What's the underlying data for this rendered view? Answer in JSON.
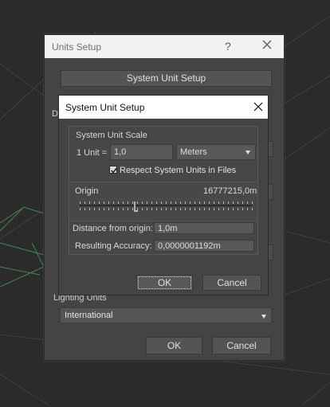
{
  "units_setup": {
    "title": "Units Setup",
    "help": "?",
    "system_unit_setup_button": "System Unit Setup",
    "lighting_units": {
      "label": "Lighting Units",
      "selected": "International"
    },
    "ok": "OK",
    "cancel": "Cancel"
  },
  "system_unit_setup": {
    "title": "System Unit Setup",
    "scale_group_label": "System Unit Scale",
    "unit_label": "1 Unit =",
    "unit_value": "1,0",
    "unit_type": "Meters",
    "respect_checkbox": {
      "label": "Respect System Units in Files",
      "checked": true
    },
    "origin_label": "Origin",
    "origin_value": "16777215,0m",
    "distance_label": "Distance from origin:",
    "distance_value": "1,0m",
    "accuracy_label": "Resulting Accuracy:",
    "accuracy_value": "0,0000001192m",
    "ok": "OK",
    "cancel": "Cancel"
  },
  "icons": {
    "outer_close": "close-icon",
    "inner_close": "close-icon",
    "combo_arrow": "chevron-down-icon"
  },
  "colors": {
    "viewport_bg": "#2b2b2b",
    "dialog_bg": "#444444",
    "grid_green": "#3a8a4f"
  }
}
